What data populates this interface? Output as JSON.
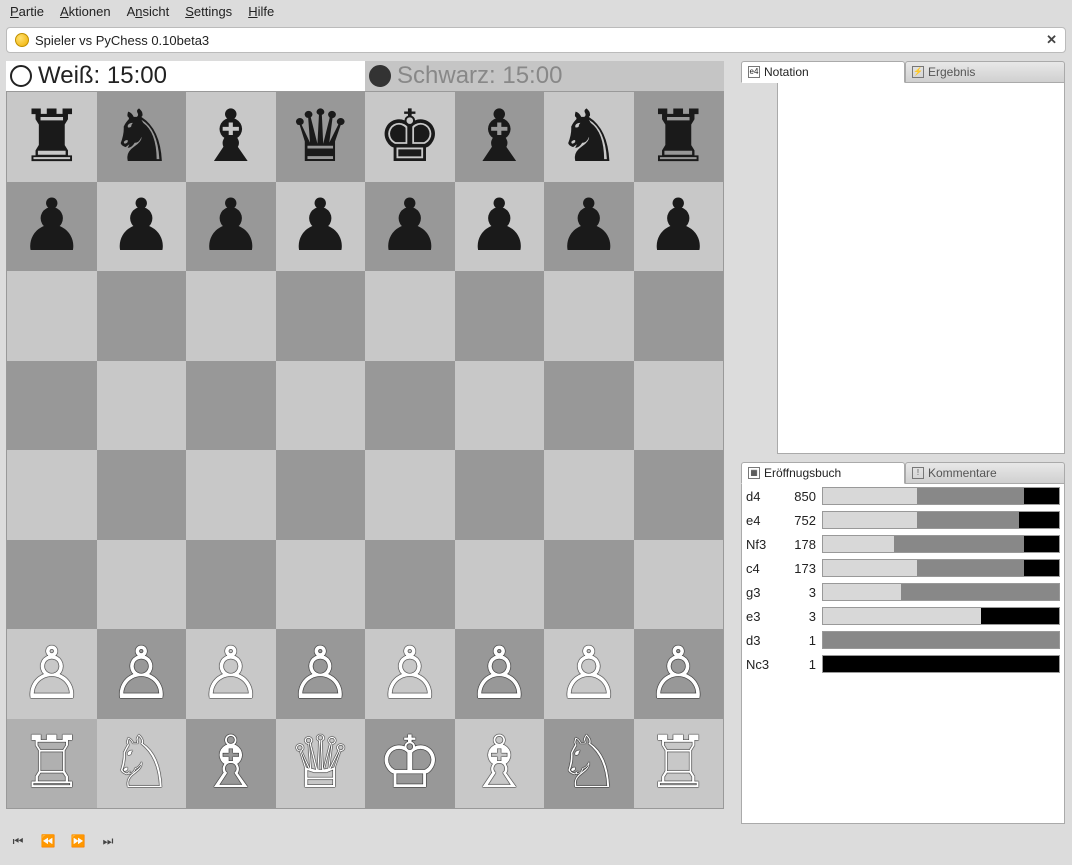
{
  "menu": {
    "items": [
      "Partie",
      "Aktionen",
      "Ansicht",
      "Settings",
      "Hilfe"
    ]
  },
  "game_tab": {
    "title": "Spieler vs PyChess 0.10beta3",
    "close": "✕"
  },
  "clocks": {
    "white_label": "Weiß: 15:00",
    "black_label": "Schwarz: 15:00"
  },
  "tabs_top": {
    "notation": "Notation",
    "ergebnis": "Ergebnis"
  },
  "tabs_bottom": {
    "opening": "Eröffnugsbuch",
    "comments": "Kommentare"
  },
  "opening": [
    {
      "move": "d4",
      "count": "850",
      "w": 40,
      "d": 45,
      "b": 15
    },
    {
      "move": "e4",
      "count": "752",
      "w": 40,
      "d": 43,
      "b": 17
    },
    {
      "move": "Nf3",
      "count": "178",
      "w": 30,
      "d": 55,
      "b": 15
    },
    {
      "move": "c4",
      "count": "173",
      "w": 40,
      "d": 45,
      "b": 15
    },
    {
      "move": "g3",
      "count": "3",
      "w": 33,
      "d": 67,
      "b": 0
    },
    {
      "move": "e3",
      "count": "3",
      "w": 67,
      "d": 0,
      "b": 33
    },
    {
      "move": "d3",
      "count": "1",
      "w": 0,
      "d": 100,
      "b": 0
    },
    {
      "move": "Nc3",
      "count": "1",
      "w": 0,
      "d": 0,
      "b": 100
    }
  ],
  "board": {
    "rows": [
      [
        "br",
        "bn",
        "bb",
        "bq",
        "bk",
        "bb",
        "bn",
        "br"
      ],
      [
        "bp",
        "bp",
        "bp",
        "bp",
        "bp",
        "bp",
        "bp",
        "bp"
      ],
      [
        "",
        "",
        "",
        "",
        "",
        "",
        "",
        ""
      ],
      [
        "",
        "",
        "",
        "",
        "",
        "",
        "",
        ""
      ],
      [
        "",
        "",
        "",
        "",
        "",
        "",
        "",
        ""
      ],
      [
        "",
        "",
        "",
        "",
        "",
        "",
        "",
        ""
      ],
      [
        "wp",
        "wp",
        "wp",
        "wp",
        "wp",
        "wp",
        "wp",
        "wp"
      ],
      [
        "wr",
        "wn",
        "wb",
        "wq",
        "wk",
        "wb",
        "wn",
        "wr"
      ]
    ]
  },
  "pieces": {
    "wk": "♔",
    "wq": "♕",
    "wr": "♖",
    "wb": "♗",
    "wn": "♘",
    "wp": "♙",
    "bk": "♚",
    "bq": "♛",
    "br": "♜",
    "bb": "♝",
    "bn": "♞",
    "bp": "♟"
  },
  "nav_icons": {
    "first": "⏮",
    "prev": "⏪",
    "next": "⏩",
    "last": "⏭"
  },
  "tab_icons": {
    "notation": "e4",
    "ergebnis": "⚡",
    "opening": "▦",
    "comments": "!"
  }
}
